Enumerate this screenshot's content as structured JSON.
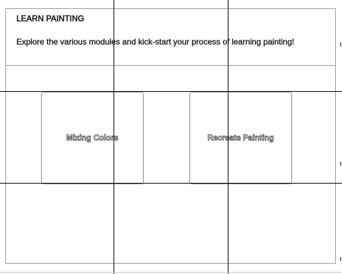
{
  "header": {
    "title": "LEARN PAINTING",
    "subtitle": "Explore the various modules and kick-start your process of learning painting!"
  },
  "modules": [
    {
      "label": "Mixing Colors"
    },
    {
      "label": "Recreate Painting"
    }
  ]
}
